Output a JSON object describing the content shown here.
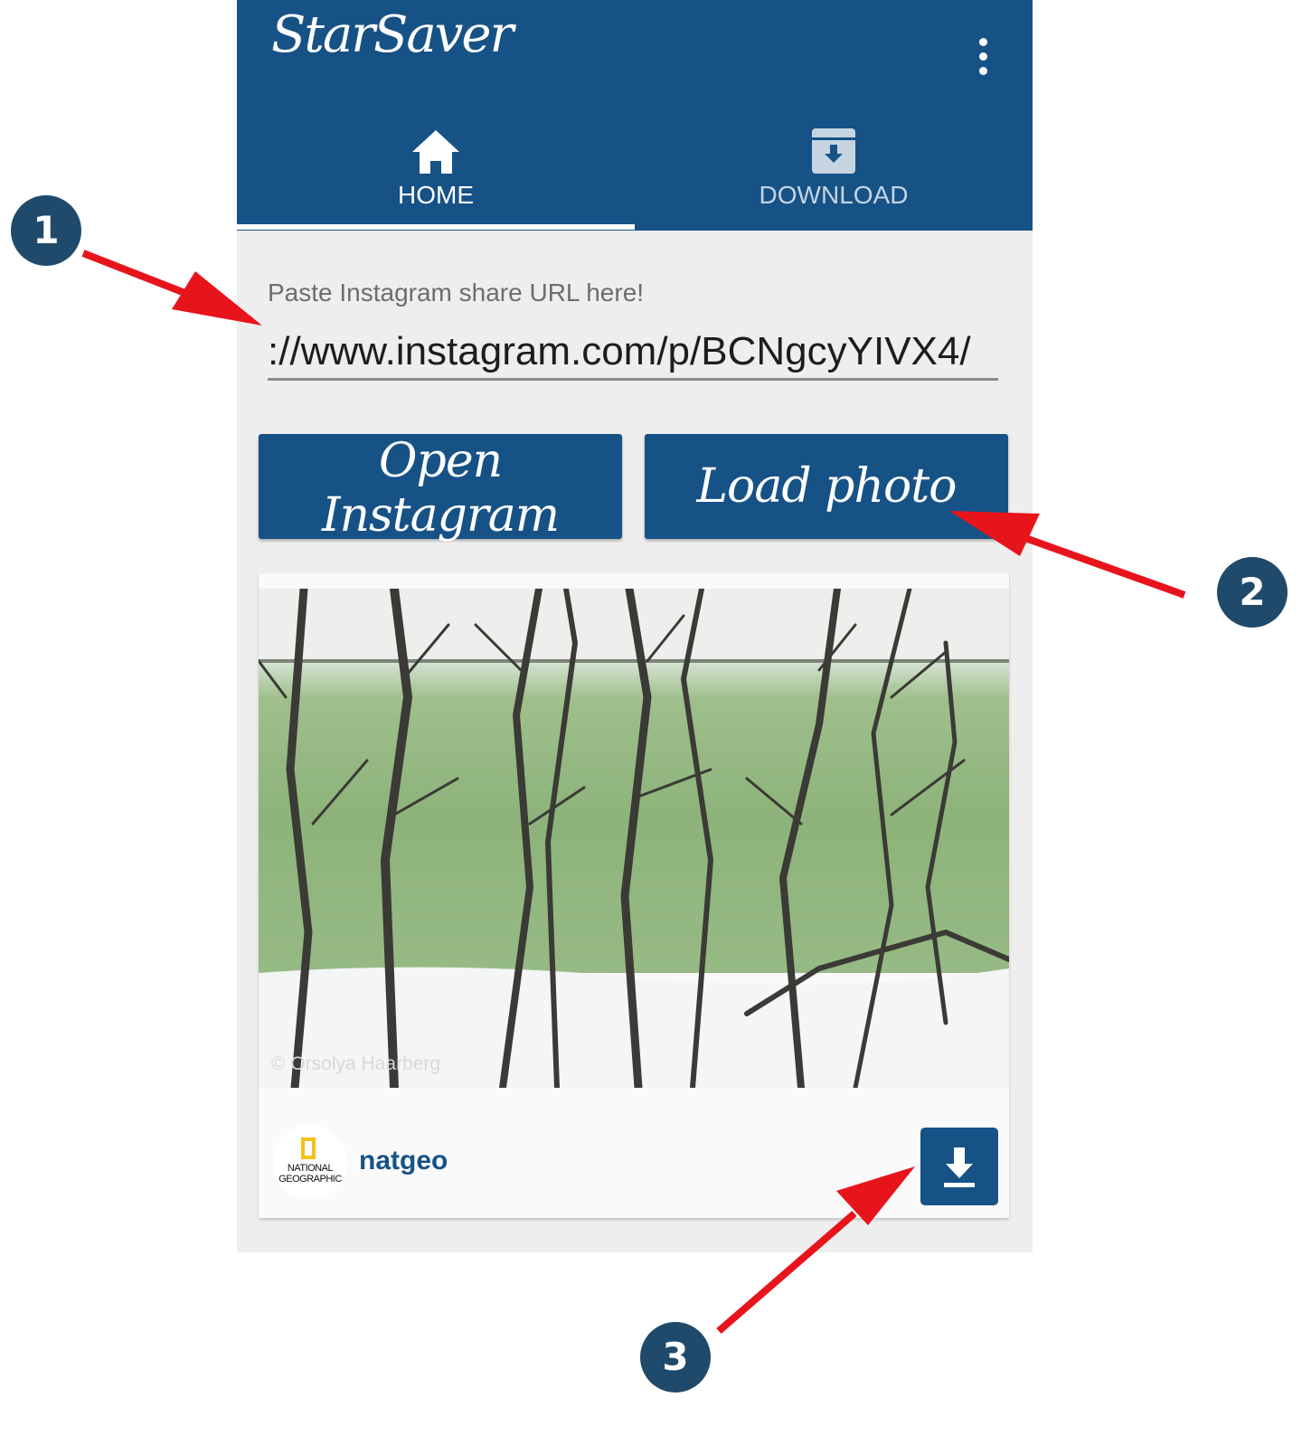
{
  "app": {
    "title": "StarSaver",
    "menu_icon": "more-vert-icon",
    "colors": {
      "primary": "#165286",
      "background": "#eeeeee",
      "annotation_arrow": "#e8141c",
      "annotation_badge": "#1f4a6b"
    }
  },
  "tabs": [
    {
      "label": "HOME",
      "icon": "home-icon",
      "selected": true
    },
    {
      "label": "DOWNLOAD",
      "icon": "archive-download-icon",
      "selected": false
    }
  ],
  "url_field": {
    "label": "Paste Instagram share URL here!",
    "value": "://www.instagram.com/p/BCNgcyYIVX4/"
  },
  "buttons": {
    "open_instagram": "Open Instagram",
    "load_photo": "Load photo"
  },
  "post": {
    "photo_credit": "© Orsolya Haarberg",
    "username": "natgeo",
    "avatar_text_line1": "NATIONAL",
    "avatar_text_line2": "GEOGRAPHIC",
    "download_icon": "download-icon"
  },
  "annotations": [
    {
      "number": "1"
    },
    {
      "number": "2"
    },
    {
      "number": "3"
    }
  ]
}
